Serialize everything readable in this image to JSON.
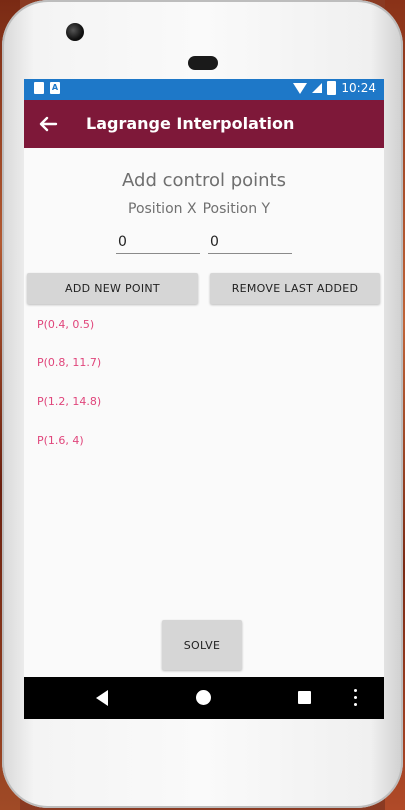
{
  "status_bar": {
    "time": "10:24",
    "notification_icon_text": "A"
  },
  "app_bar": {
    "title": "Lagrange Interpolation"
  },
  "main": {
    "heading": "Add control points",
    "label_x": "Position X",
    "label_y": "Position Y",
    "input_x_value": "0",
    "input_y_value": "0",
    "add_button_label": "ADD NEW POINT",
    "remove_button_label": "REMOVE LAST ADDED",
    "points": [
      "P(0.4, 0.5)",
      "P(0.8, 11.7)",
      "P(1.2, 14.8)",
      "P(1.6, 4)"
    ],
    "solve_button_label": "SOLVE"
  },
  "colors": {
    "app_bar": "#7e1839",
    "status_bar": "#1e78c8",
    "point_text": "#e0457b",
    "button_bg": "#d6d6d6"
  },
  "icons": [
    "back-arrow-icon",
    "nav-back-icon",
    "nav-home-icon",
    "nav-recent-icon",
    "overflow-menu-icon"
  ]
}
